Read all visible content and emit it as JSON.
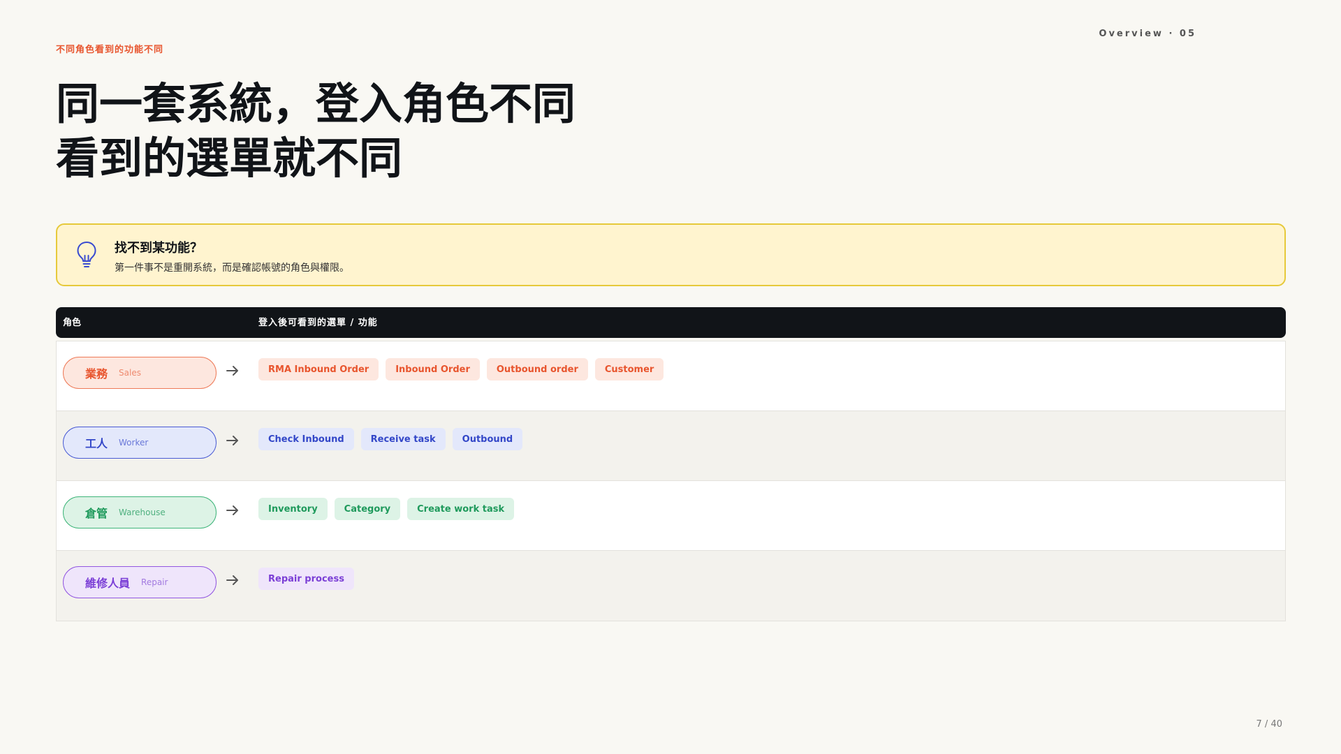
{
  "eyebrow": "不同角色看到的功能不同",
  "page_tag": "Overview · 05",
  "title": {
    "line1": "同一套系統，登入角色不同",
    "line2": "看到的選單就不同"
  },
  "callout": {
    "icon": "lightbulb-icon",
    "title": "找不到某功能？",
    "body": "第一件事不是重開系統，而是確認帳號的角色與權限。"
  },
  "table": {
    "headers": {
      "role": "角色",
      "menu": "登入後可看到的選單 / 功能"
    },
    "rows": [
      {
        "role_zh": "業務",
        "role_en": "Sales",
        "colors": {
          "text": "#e8552e",
          "bg": "#fde7df",
          "border": "#ee7a58",
          "sub": "#ee8a6e"
        },
        "items": [
          "RMA Inbound Order",
          "Inbound Order",
          "Outbound order",
          "Customer"
        ]
      },
      {
        "role_zh": "工人",
        "role_en": "Worker",
        "colors": {
          "text": "#3347c8",
          "bg": "#e3e8fb",
          "border": "#4a5bd4",
          "sub": "#6a78d8"
        },
        "items": [
          "Check Inbound",
          "Receive task",
          "Outbound"
        ]
      },
      {
        "role_zh": "倉管",
        "role_en": "Warehouse",
        "colors": {
          "text": "#1f9a5c",
          "bg": "#ddf3e6",
          "border": "#3fb57a",
          "sub": "#4fb07f"
        },
        "items": [
          "Inventory",
          "Category",
          "Create work task"
        ]
      },
      {
        "role_zh": "維修人員",
        "role_en": "Repair",
        "colors": {
          "text": "#7b3fd6",
          "bg": "#efe5fb",
          "border": "#9257e0",
          "sub": "#a27ae0"
        },
        "items": [
          "Repair process"
        ]
      }
    ]
  },
  "pager": "7 / 40"
}
